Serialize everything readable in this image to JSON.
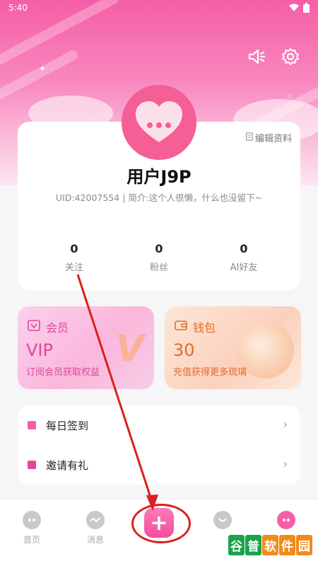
{
  "status_bar": {
    "time": "5:40"
  },
  "profile": {
    "edit_label": "编辑资料",
    "username": "用户J9P",
    "bio": "UID:42007554 | 简介:这个人很懒，什么也没留下~",
    "stats": [
      {
        "value": "0",
        "label": "关注"
      },
      {
        "value": "0",
        "label": "粉丝"
      },
      {
        "value": "0",
        "label": "AI好友"
      }
    ]
  },
  "promos": {
    "vip": {
      "title": "会员",
      "big": "VIP",
      "subtitle": "订阅会员获取权益"
    },
    "wallet": {
      "title": "钱包",
      "big": "30",
      "subtitle": "充值获得更多琉璃"
    }
  },
  "menu": [
    {
      "label": "每日签到",
      "icon": "calendar-icon"
    },
    {
      "label": "邀请有礼",
      "icon": "gift-icon"
    }
  ],
  "tabbar": [
    {
      "label": "首页",
      "icon": "home-icon"
    },
    {
      "label": "消息",
      "icon": "message-icon"
    },
    {
      "label": "",
      "icon": "plus-icon"
    },
    {
      "label": "",
      "icon": "discover-icon"
    },
    {
      "label": "",
      "icon": "profile-icon"
    }
  ],
  "watermark": [
    "谷",
    "普",
    "软",
    "件",
    "园"
  ],
  "colors": {
    "accent": "#f55ea6",
    "vip": "#e0479a",
    "wallet": "#e36a2c",
    "annotation": "#d8201e"
  }
}
